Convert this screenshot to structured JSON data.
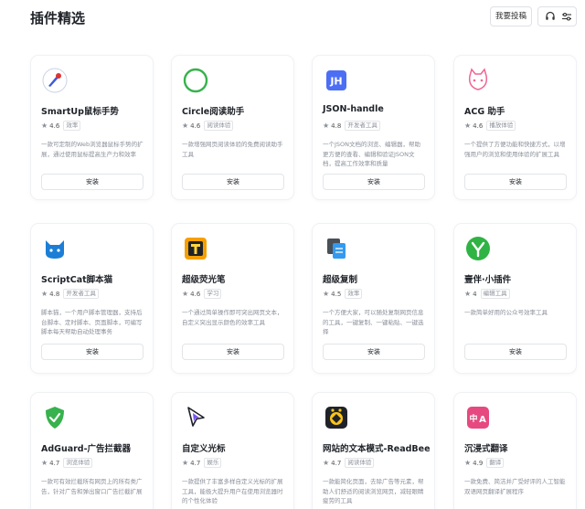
{
  "header": {
    "title": "插件精选",
    "submit_label": "我要投稿",
    "icons": [
      "headset-icon",
      "sliders-icon"
    ]
  },
  "plugins": [
    {
      "name": "SmartUp鼠标手势",
      "rating": "4.6",
      "tag": "效率",
      "desc": "一款可定制的Web浏览器鼠标手势的扩展，通过使用鼠标提高生产力和效率",
      "install": "安装",
      "icon": "smartup-icon"
    },
    {
      "name": "Circle阅读助手",
      "rating": "4.6",
      "tag": "阅读体验",
      "desc": "一款增强网页阅读体验的免费阅读助手工具",
      "install": "安装",
      "icon": "circle-icon"
    },
    {
      "name": "JSON-handle",
      "rating": "4.8",
      "tag": "开发者工具",
      "desc": "一个JSON文档的浏览、编辑器，帮助更方便的查看、编辑和验证JSON文档，提高工作效率和质量",
      "install": "安装",
      "icon": "jh-icon"
    },
    {
      "name": "ACG 助手",
      "rating": "4.6",
      "tag": "播放体验",
      "desc": "一个提供了方便功能和快捷方式，以增强用户的浏览和使用体验的扩展工具",
      "install": "安装",
      "icon": "cat-icon"
    },
    {
      "name": "ScriptCat脚本猫",
      "rating": "4.8",
      "tag": "开发者工具",
      "desc": "脚本猫，一个用户脚本管理器，支持后台脚本、定时脚本、页面脚本，可编写脚本每天帮助自动处理事务",
      "install": "安装",
      "icon": "scriptcat-icon"
    },
    {
      "name": "超级荧光笔",
      "rating": "4.6",
      "tag": "学习",
      "desc": "一个通过简单操作即可突出网页文本，自定义突出显示颜色的效率工具",
      "install": "安装",
      "icon": "highlighter-icon"
    },
    {
      "name": "超级复制",
      "rating": "4.5",
      "tag": "效率",
      "desc": "一个方便大家，可以随处复制网页信息的工具，一键复制、一键粘贴、一键选择",
      "install": "安装",
      "icon": "copy-icon"
    },
    {
      "name": "壹伴·小插件",
      "rating": "4",
      "tag": "编辑工具",
      "desc": "一款简单好用的公众号效率工具",
      "install": "安装",
      "icon": "yiban-icon"
    },
    {
      "name": "AdGuard-广告拦截器",
      "rating": "4.7",
      "tag": "浏览体验",
      "desc": "一款可有效拦截所有网页上的所有类广告，针对广告和弹出窗口广告拦截扩展",
      "install": "安装",
      "icon": "shield-check-icon"
    },
    {
      "name": "自定义光标",
      "rating": "4.7",
      "tag": "娱乐",
      "desc": "一款提供了丰富多样自定义光标的扩展工具，能极大提升用户在使用浏览器时的个性化体验",
      "install": "安装",
      "icon": "cursor-icon"
    },
    {
      "name": "网站的文本模式-ReadBee",
      "rating": "4.7",
      "tag": "阅读体验",
      "desc": "一款能简化页面，去除广告等元素，帮助人们舒适的阅读浏览网页，减轻眼睛疲劳的工具",
      "install": "安装",
      "icon": "readbee-icon"
    },
    {
      "name": "沉浸式翻译",
      "rating": "4.9",
      "tag": "翻译",
      "desc": "一款免费、简洁并广受好评的人工智能双语网页翻译扩展程序",
      "install": "安装",
      "icon": "translate-icon"
    }
  ]
}
